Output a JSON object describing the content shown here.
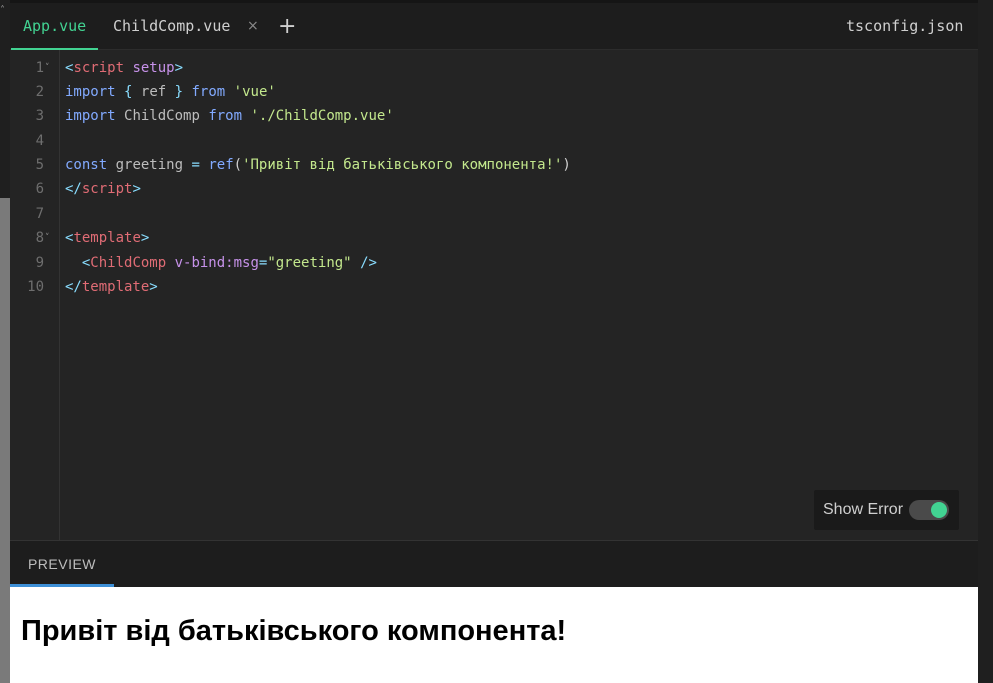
{
  "tabs": [
    {
      "label": "App.vue",
      "active": true
    },
    {
      "label": "ChildComp.vue",
      "active": false
    }
  ],
  "tab_close_glyph": "×",
  "tab_add_glyph": "+",
  "right_tab": {
    "label": "tsconfig.json"
  },
  "editor": {
    "line_numbers": [
      "1",
      "2",
      "3",
      "4",
      "5",
      "6",
      "7",
      "8",
      "9",
      "10"
    ],
    "code": {
      "l1": {
        "open": "<",
        "tag": "script",
        "attr": "setup",
        "close": ">"
      },
      "l2": {
        "kw": "import",
        "brace_open": "{",
        "id": "ref",
        "brace_close": "}",
        "from": "from",
        "str": "'vue'"
      },
      "l3": {
        "kw": "import",
        "id": "ChildComp",
        "from": "from",
        "str": "'./ChildComp.vue'"
      },
      "l5": {
        "kw": "const",
        "id": "greeting",
        "eq": "=",
        "fn": "ref",
        "paren_open": "(",
        "str": "'Привіт від батьківського компонента!'",
        "paren_close": ")"
      },
      "l6": {
        "open": "</",
        "tag": "script",
        "close": ">"
      },
      "l8": {
        "open": "<",
        "tag": "template",
        "close": ">"
      },
      "l9": {
        "open": "<",
        "tag": "ChildComp",
        "attr": "v-bind:msg",
        "eq": "=",
        "str": "\"greeting\"",
        "close": "/>"
      },
      "l10": {
        "open": "</",
        "tag": "template",
        "close": ">"
      }
    }
  },
  "show_error": {
    "label": "Show Error",
    "enabled": true
  },
  "preview": {
    "tab_label": "PREVIEW",
    "heading": "Привіт від батьківського компонента!"
  },
  "colors": {
    "accent_green": "#42d392",
    "accent_blue": "#3d8fd6",
    "tag_red": "#e06c75",
    "string_green": "#c3e88d",
    "keyword_blue": "#82aaff",
    "attr_purple": "#c792ea"
  },
  "icons": {
    "fold": "chevron-down-icon",
    "close": "close-icon",
    "add": "plus-icon"
  }
}
